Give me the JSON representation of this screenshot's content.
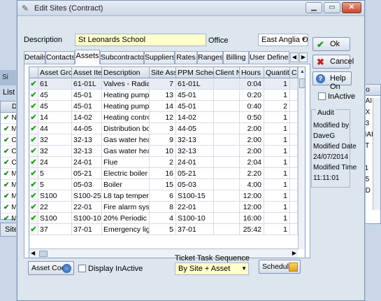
{
  "background": {
    "window_title_sliver": "Si",
    "list_label": "List",
    "left_grid": {
      "header": "Di",
      "rows": [
        {
          "check": "✔",
          "text": "Ni"
        },
        {
          "check": "✔",
          "text": "M/"
        },
        {
          "check": "✔",
          "text": "C/"
        },
        {
          "check": "✔",
          "text": "C/"
        },
        {
          "check": "✔",
          "text": "C/"
        },
        {
          "check": "✔",
          "text": "M/"
        },
        {
          "check": "✔",
          "text": "M/"
        },
        {
          "check": "✔",
          "text": "M/"
        },
        {
          "check": "✔",
          "text": "M/"
        },
        {
          "check": "✔",
          "text": "M/"
        }
      ]
    },
    "sites_tab": "Sites",
    "right_panel": {
      "header": "Co",
      "rows": [
        "SAI",
        "EX",
        "Y3",
        "MAI",
        "FT",
        "",
        "21",
        "Y5",
        "AD"
      ]
    }
  },
  "dialog": {
    "title": "Edit Sites (Contract)",
    "window_buttons": {
      "minimize": "▁",
      "maximize": "▭",
      "close": "✕"
    },
    "description_label": "Description",
    "description_value": "St Leonards School",
    "office_label": "Office",
    "office_value": "East Anglia Off",
    "tabs": [
      "Details",
      "Contacts",
      "Assets",
      "Subcontractors",
      "Suppliers",
      "Rates",
      "Ranges",
      "Billing",
      "User Defined"
    ],
    "active_tab": "Assets",
    "grid": {
      "columns": [
        "",
        "Asset Group",
        "Asset Item",
        "Description",
        "Site Asset",
        "PPM Schedule",
        "Client No",
        "Hours",
        "Quantity",
        "C"
      ],
      "rows": [
        {
          "check": "✔",
          "group": "61",
          "item": "61-01L",
          "desc": "Valves - Radiator T",
          "site_asset": "7",
          "ppm": "61-01L",
          "client": "",
          "hours": "0:04",
          "qty": "1"
        },
        {
          "check": "✔",
          "group": "45",
          "item": "45-01",
          "desc": "Heating pump Nurs",
          "site_asset": "13",
          "ppm": "45-01",
          "client": "",
          "hours": "0:20",
          "qty": "1"
        },
        {
          "check": "✔",
          "group": "45",
          "item": "45-01",
          "desc": "Heating pumps in n",
          "site_asset": "14",
          "ppm": "45-01",
          "client": "",
          "hours": "0:40",
          "qty": "2"
        },
        {
          "check": "✔",
          "group": "14",
          "item": "14-02",
          "desc": "Heating control pa",
          "site_asset": "12",
          "ppm": "14-02",
          "client": "",
          "hours": "0:50",
          "qty": "1"
        },
        {
          "check": "✔",
          "group": "44",
          "item": "44-05",
          "desc": "Distribution boards",
          "site_asset": "3",
          "ppm": "44-05",
          "client": "",
          "hours": "2:00",
          "qty": "1"
        },
        {
          "check": "✔",
          "group": "32",
          "item": "32-13",
          "desc": "Gas water heater",
          "site_asset": "9",
          "ppm": "32-13",
          "client": "",
          "hours": "2:00",
          "qty": "1"
        },
        {
          "check": "✔",
          "group": "32",
          "item": "32-13",
          "desc": "Gas water heater",
          "site_asset": "10",
          "ppm": "32-13",
          "client": "",
          "hours": "2:00",
          "qty": "1"
        },
        {
          "check": "✔",
          "group": "24",
          "item": "24-01",
          "desc": "Flue",
          "site_asset": "2",
          "ppm": "24-01",
          "client": "",
          "hours": "2:04",
          "qty": "1"
        },
        {
          "check": "✔",
          "group": "5",
          "item": "05-21",
          "desc": "Electric boiler in Nu",
          "site_asset": "16",
          "ppm": "05-21",
          "client": "",
          "hours": "2:20",
          "qty": "1"
        },
        {
          "check": "✔",
          "group": "5",
          "item": "05-03",
          "desc": "Boiler",
          "site_asset": "15",
          "ppm": "05-03",
          "client": "",
          "hours": "4:00",
          "qty": "1"
        },
        {
          "check": "✔",
          "group": "S100",
          "item": "S100-25",
          "desc": "L8 tap temperatur",
          "site_asset": "6",
          "ppm": "S100-15",
          "client": "",
          "hours": "12:00",
          "qty": "1"
        },
        {
          "check": "✔",
          "group": "22",
          "item": "22-01",
          "desc": "Fire alarm system",
          "site_asset": "8",
          "ppm": "22-01",
          "client": "",
          "hours": "12:00",
          "qty": "1"
        },
        {
          "check": "✔",
          "group": "S100",
          "item": "S100-10",
          "desc": "20% Periodic test",
          "site_asset": "4",
          "ppm": "S100-10",
          "client": "",
          "hours": "16:00",
          "qty": "1"
        },
        {
          "check": "✔",
          "group": "37",
          "item": "37-01",
          "desc": "Emergency lighting",
          "site_asset": "5",
          "ppm": "37-01",
          "client": "",
          "hours": "25:42",
          "qty": "1"
        }
      ]
    },
    "asset_code_button": "Asset Code",
    "display_inactive_label": "Display InActive",
    "ticket_task_sequence_label": "Ticket Task Sequence",
    "ticket_task_sequence_value": "By Site + Asset",
    "schedule_button": "Schedule",
    "ok_button": "Ok",
    "cancel_button": "Cancel",
    "help_button": "Help On",
    "inactive_label": "InActive",
    "audit": {
      "title": "Audit",
      "modified_by_label": "Modified by",
      "modified_by_value": "DaveG",
      "modified_date_label": "Modified Date",
      "modified_date_value": "24/07/2014",
      "modified_time_label": "Modified Time",
      "modified_time_value": "11:11:01"
    }
  }
}
